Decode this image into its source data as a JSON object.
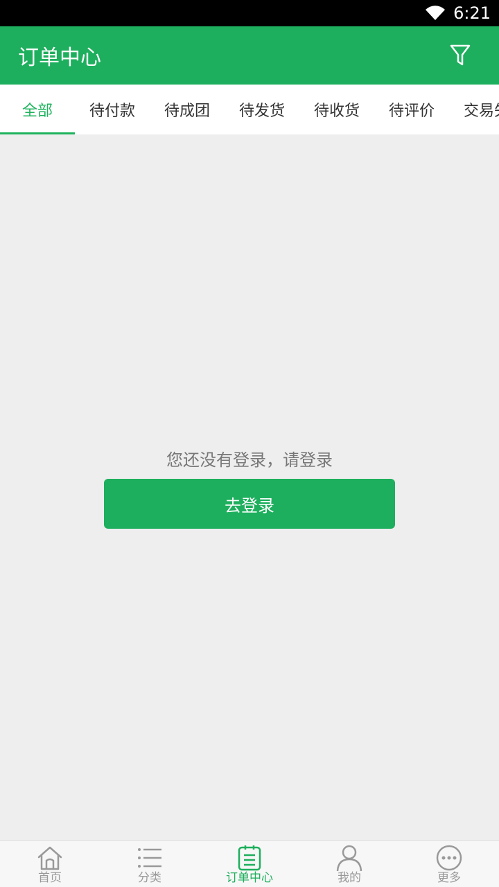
{
  "status": {
    "time": "6:21"
  },
  "header": {
    "title": "订单中心"
  },
  "tabs": [
    {
      "label": "全部",
      "active": true
    },
    {
      "label": "待付款"
    },
    {
      "label": "待成团"
    },
    {
      "label": "待发货"
    },
    {
      "label": "待收货"
    },
    {
      "label": "待评价"
    },
    {
      "label": "交易失"
    }
  ],
  "main": {
    "empty_message": "您还没有登录，请登录",
    "login_button": "去登录"
  },
  "bottom_nav": [
    {
      "label": "首页",
      "icon": "home-icon"
    },
    {
      "label": "分类",
      "icon": "list-icon"
    },
    {
      "label": "订单中心",
      "icon": "order-icon",
      "active": true
    },
    {
      "label": "我的",
      "icon": "user-icon"
    },
    {
      "label": "更多",
      "icon": "more-icon"
    }
  ],
  "colors": {
    "primary": "#1daf5d",
    "tab_active": "#1db35c",
    "background": "#eeeeee"
  }
}
